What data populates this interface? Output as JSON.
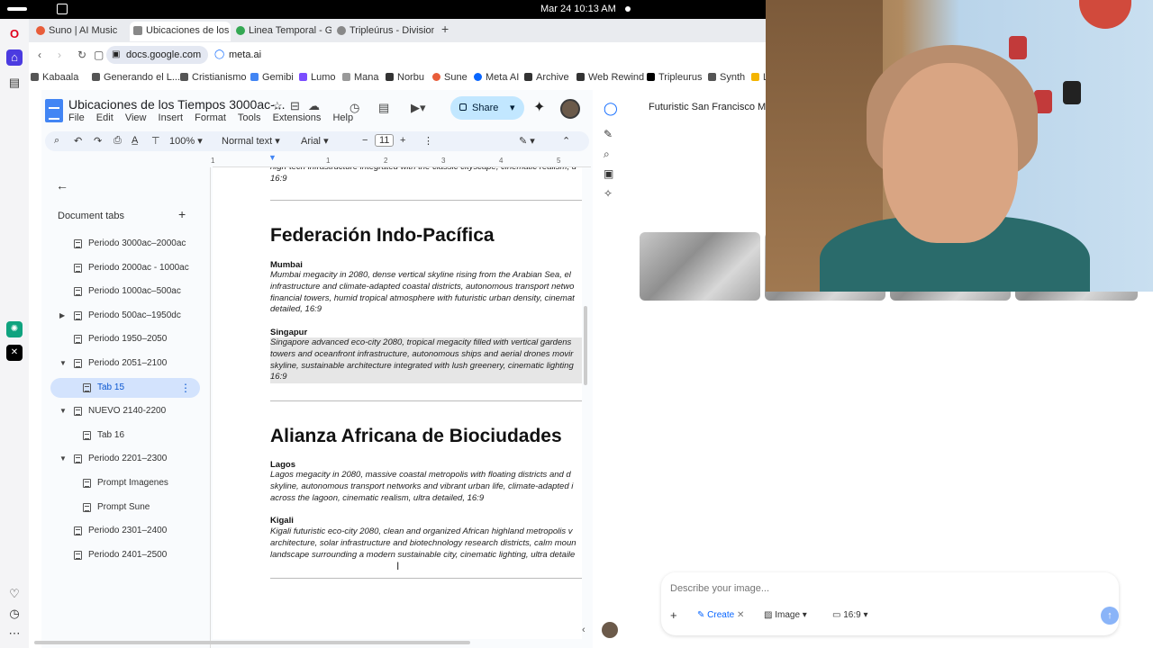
{
  "os": {
    "clock": "Mar 24  10:13 AM"
  },
  "browser": {
    "tabs": [
      {
        "label": "Suno | AI Music",
        "color": "#e85d3a"
      },
      {
        "label": "Ubicaciones de los T",
        "color": "#888888"
      },
      {
        "label": "Linea Temporal - Go",
        "color": "#34a853"
      },
      {
        "label": "Tripleúrus - Divisione",
        "color": "#888888"
      }
    ],
    "new_tab": "+",
    "url_pills": [
      "docs.google.com",
      "meta.ai"
    ],
    "bookmarks": [
      "Kabaala",
      "Generando el L...",
      "Cristianismo",
      "Gemibi",
      "Lumo",
      "Mana",
      "Norbu",
      "Sune",
      "Meta AI",
      "Archive",
      "Web Rewind",
      "Tripleurus",
      "Synth",
      "L"
    ]
  },
  "docs": {
    "title": "Ubicaciones de los Tiempos 3000ac-...",
    "menus": [
      "File",
      "Edit",
      "View",
      "Insert",
      "Format",
      "Tools",
      "Extensions",
      "Help"
    ],
    "share_label": "Share",
    "toolbar": {
      "zoom": "100%",
      "style": "Normal text",
      "font": "Arial",
      "size": "11"
    },
    "ruler_marks": [
      "1",
      "1",
      "2",
      "3",
      "4",
      "5"
    ],
    "tabs_pane": {
      "heading": "Document tabs",
      "items": [
        {
          "label": "Periodo 3000ac–2000ac",
          "depth": 0,
          "chev": ""
        },
        {
          "label": "Periodo 2000ac - 1000ac",
          "depth": 0,
          "chev": ""
        },
        {
          "label": "Periodo 1000ac–500ac",
          "depth": 0,
          "chev": ""
        },
        {
          "label": "Periodo 500ac–1950dc",
          "depth": 0,
          "chev": "▶"
        },
        {
          "label": "Periodo 1950–2050",
          "depth": 0,
          "chev": ""
        },
        {
          "label": "Periodo 2051–2100",
          "depth": 0,
          "chev": "▼"
        },
        {
          "label": "Tab 15",
          "depth": 1,
          "chev": "",
          "selected": true
        },
        {
          "label": "NUEVO 2140-2200",
          "depth": 0,
          "chev": "▼"
        },
        {
          "label": "Tab 16",
          "depth": 1,
          "chev": ""
        },
        {
          "label": "Periodo 2201–2300",
          "depth": 0,
          "chev": "▼"
        },
        {
          "label": "Prompt Imagenes",
          "depth": 1,
          "chev": ""
        },
        {
          "label": "Prompt Sune",
          "depth": 1,
          "chev": ""
        },
        {
          "label": "Periodo 2301–2400",
          "depth": 0,
          "chev": ""
        },
        {
          "label": "Periodo 2401–2500",
          "depth": 0,
          "chev": ""
        }
      ]
    },
    "content": {
      "top_fragment": "high-tech infrastructure integrated with the classic cityscape, cinematic realism, u\n16:9",
      "sections": [
        {
          "heading": "Federación Indo-Pacífica",
          "cities": [
            {
              "name": "Mumbai",
              "text": " Mumbai megacity in 2080, dense vertical skyline rising from the Arabian Sea, el\ninfrastructure and climate-adapted coastal districts, autonomous transport netwo\nfinancial towers, humid tropical atmosphere with futuristic urban density, cinemat\ndetailed, 16:9"
            },
            {
              "name": "Singapur",
              "text": " Singapore advanced eco-city 2080, tropical megacity filled with vertical gardens\ntowers and oceanfront infrastructure, autonomous ships and aerial drones movir\nskyline, sustainable architecture integrated with lush greenery, cinematic lighting\n16:9"
            }
          ]
        },
        {
          "heading": "Alianza Africana de Biociudades",
          "cities": [
            {
              "name": "Lagos",
              "text": " Lagos megacity in 2080, massive coastal metropolis with floating districts and d\nskyline, autonomous transport networks and vibrant urban life, climate-adapted i\nacross the lagoon, cinematic realism, ultra detailed, 16:9"
            },
            {
              "name": "Kigali",
              "text": " Kigali futuristic eco-city 2080, clean and organized African highland metropolis v\narchitecture, solar infrastructure and biotechnology research districts, calm moun\nlandscape surrounding a modern sustainable city, cinematic lighting, ultra detaile"
            }
          ]
        }
      ]
    }
  },
  "meta": {
    "conversation_title": "Futuristic San Francisco Me",
    "prompt_placeholder": "Describe your image...",
    "create_label": "Create",
    "image_label": "Image",
    "ratio_label": "16:9"
  }
}
